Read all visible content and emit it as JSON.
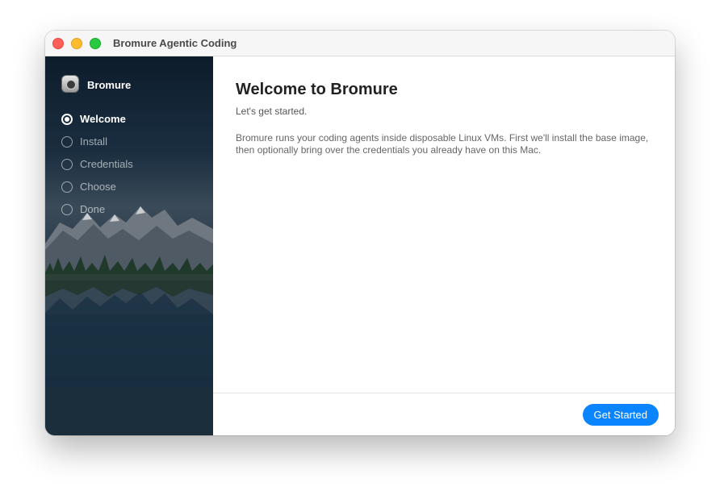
{
  "window": {
    "title": "Bromure Agentic Coding"
  },
  "sidebar": {
    "brand_name": "Bromure",
    "brand_icon": "bromure-logo-icon",
    "steps": [
      {
        "label": "Welcome",
        "state": "active"
      },
      {
        "label": "Install",
        "state": "pending"
      },
      {
        "label": "Credentials",
        "state": "pending"
      },
      {
        "label": "Choose",
        "state": "pending"
      },
      {
        "label": "Done",
        "state": "pending"
      }
    ]
  },
  "main": {
    "heading": "Welcome to Bromure",
    "subheading": "Let's get started.",
    "description": "Bromure runs your coding agents inside disposable Linux VMs. First we'll install the base image, then optionally bring over the credentials you already have on this Mac."
  },
  "footer": {
    "primary_button": "Get Started"
  },
  "colors": {
    "accent": "#0a84ff",
    "close": "#ff5f57",
    "minimize": "#febc2e",
    "maximize": "#28c840"
  }
}
